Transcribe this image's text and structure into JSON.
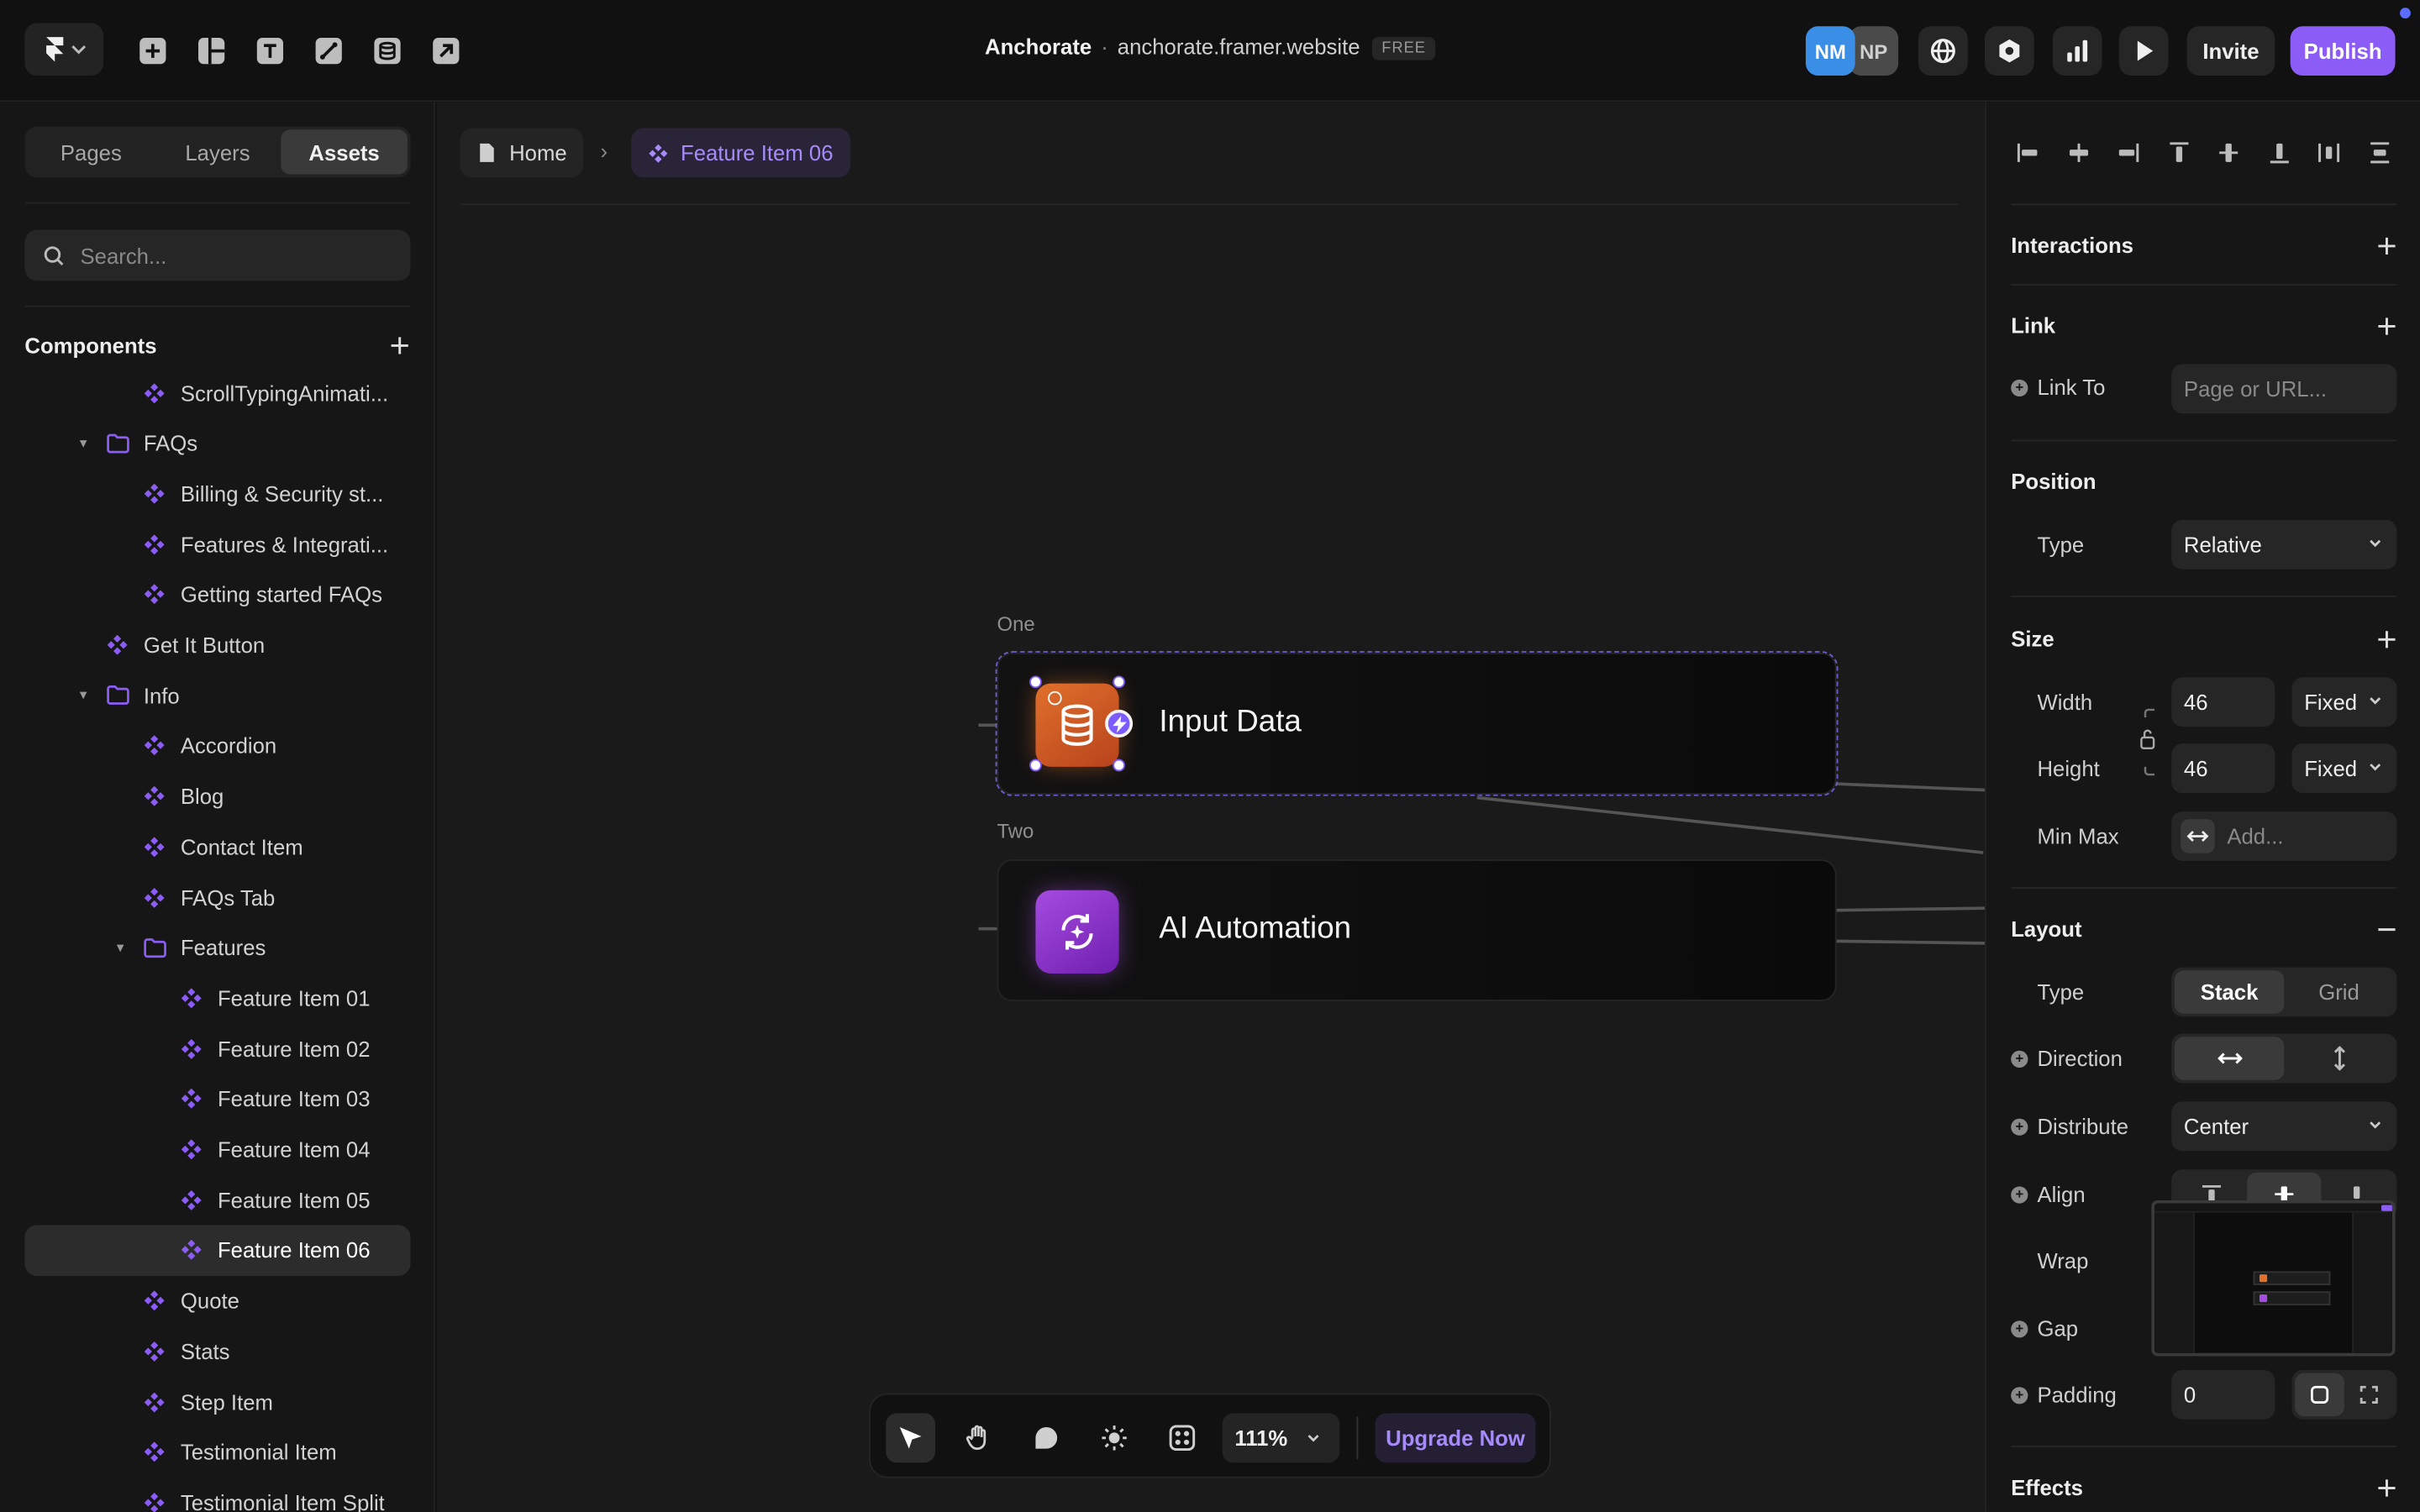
{
  "topbar": {
    "project_name": "Anchorate",
    "separator": "·",
    "site_url": "anchorate.framer.website",
    "plan_badge": "FREE",
    "avatars": [
      "NM",
      "NP"
    ],
    "invite_label": "Invite",
    "publish_label": "Publish"
  },
  "left_panel": {
    "tabs": [
      "Pages",
      "Layers",
      "Assets"
    ],
    "active_tab": "Assets",
    "search_placeholder": "Search...",
    "components_title": "Components",
    "tree": [
      {
        "label": "ScrollTypingAnimati...",
        "type": "component",
        "depth": 2
      },
      {
        "label": "FAQs",
        "type": "folder",
        "depth": 1,
        "open": true
      },
      {
        "label": "Billing & Security st...",
        "type": "component",
        "depth": 2
      },
      {
        "label": "Features & Integrati...",
        "type": "component",
        "depth": 2
      },
      {
        "label": "Getting started FAQs",
        "type": "component",
        "depth": 2
      },
      {
        "label": "Get It Button",
        "type": "component",
        "depth": 1
      },
      {
        "label": "Info",
        "type": "folder",
        "depth": 1,
        "open": true
      },
      {
        "label": "Accordion",
        "type": "component",
        "depth": 2
      },
      {
        "label": "Blog",
        "type": "component",
        "depth": 2
      },
      {
        "label": "Contact Item",
        "type": "component",
        "depth": 2
      },
      {
        "label": "FAQs Tab",
        "type": "component",
        "depth": 2
      },
      {
        "label": "Features",
        "type": "folder",
        "depth": 2,
        "open": true
      },
      {
        "label": "Feature Item 01",
        "type": "component",
        "depth": 3
      },
      {
        "label": "Feature Item 02",
        "type": "component",
        "depth": 3
      },
      {
        "label": "Feature Item 03",
        "type": "component",
        "depth": 3
      },
      {
        "label": "Feature Item 04",
        "type": "component",
        "depth": 3
      },
      {
        "label": "Feature Item 05",
        "type": "component",
        "depth": 3
      },
      {
        "label": "Feature Item 06",
        "type": "component",
        "depth": 3,
        "selected": true
      },
      {
        "label": "Quote",
        "type": "component",
        "depth": 2
      },
      {
        "label": "Stats",
        "type": "component",
        "depth": 2
      },
      {
        "label": "Step Item",
        "type": "component",
        "depth": 2
      },
      {
        "label": "Testimonial Item",
        "type": "component",
        "depth": 2
      },
      {
        "label": "Testimonial Item Split",
        "type": "component",
        "depth": 2
      }
    ]
  },
  "canvas": {
    "breadcrumb_home": "Home",
    "breadcrumb_current": "Feature Item 06",
    "frames": [
      {
        "label": "One",
        "title": "Input Data",
        "icon": "database-icon",
        "color": "#e0702c"
      },
      {
        "label": "Two",
        "title": "AI Automation",
        "icon": "ai-sync-icon",
        "color": "#a54be0"
      }
    ],
    "zoom": "111%",
    "upgrade_label": "Upgrade Now"
  },
  "right_panel": {
    "interactions": "Interactions",
    "link": {
      "title": "Link",
      "link_to_label": "Link To",
      "placeholder": "Page or URL..."
    },
    "position": {
      "title": "Position",
      "type_label": "Type",
      "type_value": "Relative"
    },
    "size": {
      "title": "Size",
      "width_label": "Width",
      "width_value": "46",
      "width_mode": "Fixed",
      "height_label": "Height",
      "height_value": "46",
      "height_mode": "Fixed",
      "minmax_label": "Min Max",
      "minmax_placeholder": "Add..."
    },
    "layout": {
      "title": "Layout",
      "type_label": "Type",
      "type_options": [
        "Stack",
        "Grid"
      ],
      "type_selected": "Stack",
      "direction_label": "Direction",
      "distribute_label": "Distribute",
      "distribute_value": "Center",
      "align_label": "Align",
      "wrap_label": "Wrap",
      "gap_label": "Gap",
      "padding_label": "Padding",
      "padding_value": "0"
    },
    "effects": "Effects"
  },
  "colors": {
    "accent": "#8b5cf6",
    "component_icon": "#8b5cf6",
    "folder_icon": "#8b5cf6"
  }
}
